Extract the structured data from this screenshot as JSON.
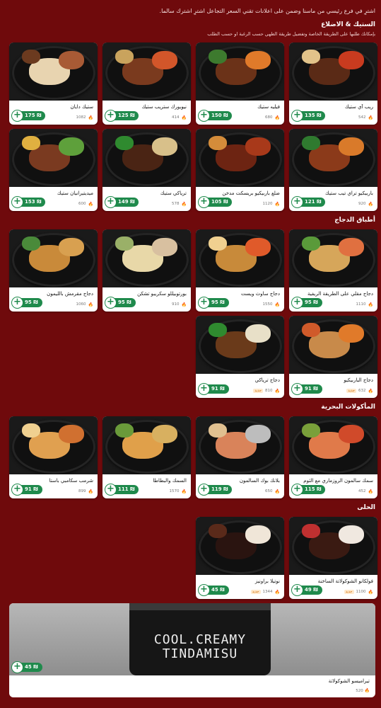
{
  "top_note": "اشترِ في فرع رئيسي من ماسنا وضمن على اعلانات تقني السعر التجاعل اشترِ اشترك سالما.",
  "sections": {
    "steak": {
      "title": "الستيك & الاضلاع",
      "subtitle": "بإمكانك طلبها على الطريقة الخاصة وتفضيل طريقة الطهي حسب الرغبة او حسب الطلب"
    },
    "chicken": {
      "title": "أطباق الدجاج"
    },
    "seafood": {
      "title": "المأكولات البحرية"
    },
    "desserts": {
      "title": "الحلى"
    }
  },
  "items": [
    {
      "name": "ريب آي ستيك",
      "price": "135",
      "kcal": "542"
    },
    {
      "name": "فيليه ستيك",
      "price": "150",
      "kcal": "680"
    },
    {
      "name": "نيويورك ستريب ستيك",
      "price": "125",
      "kcal": "414"
    },
    {
      "name": "ستيك دايان",
      "price": "175",
      "kcal": "1082"
    },
    {
      "name": "باربيكيو تراي تيب ستيك",
      "price": "121",
      "kcal": "920"
    },
    {
      "name": "ضلع باربيكيو بريسكت مدخن",
      "price": "105",
      "kcal": "1120"
    },
    {
      "name": "ترياكي ستيك",
      "price": "149",
      "kcal": "578"
    },
    {
      "name": "ميديتيرانيان ستيك",
      "price": "153",
      "kcal": "600"
    },
    {
      "name": "دجاج مقلي على الطريقة الريفية",
      "price": "95",
      "kcal": "1110"
    },
    {
      "name": "دجاج ساوث ويست",
      "price": "95",
      "kcal": "1550"
    },
    {
      "name": "بورتوبيللو سكريبو تشكن",
      "price": "95",
      "kcal": "910"
    },
    {
      "name": "دجاج مقرمش بالليمون",
      "price": "95",
      "kcal": "1060"
    },
    {
      "name": "دجاج الباربيكيو",
      "price": "91",
      "kcal": "632",
      "tag": "جديد"
    },
    {
      "name": "دجاج ترياكي",
      "price": "91",
      "kcal": "810",
      "tag": "جديد"
    },
    {
      "name": "سمك سالمون الروزماري مع الثوم",
      "price": "115",
      "kcal": "452"
    },
    {
      "name": "بلانك بوك السالمون",
      "price": "119",
      "kcal": "650"
    },
    {
      "name": "السمك والبطاطا",
      "price": "111",
      "kcal": "1570"
    },
    {
      "name": "شرمب سكامبي باستا",
      "price": "91",
      "kcal": "899"
    },
    {
      "name": "فولكانو الشوكولاتة الساخنة",
      "price": "49",
      "kcal": "1100",
      "tag": "جديد"
    },
    {
      "name": "نوتيلا براونيز",
      "price": "45",
      "kcal": "1344",
      "tag": "جديد"
    }
  ],
  "wide_item": {
    "name": "تيراميسو الشوكولاتة",
    "price": "45",
    "kcal": "520",
    "cup_text": "COOL.CREAMY TINDAMISU"
  },
  "icons": {
    "add": "plus-icon",
    "calories": "flame-icon",
    "price": "currency-icon"
  },
  "colors": {
    "background": "#6f0a0c",
    "accent": "#1f8a4c"
  }
}
